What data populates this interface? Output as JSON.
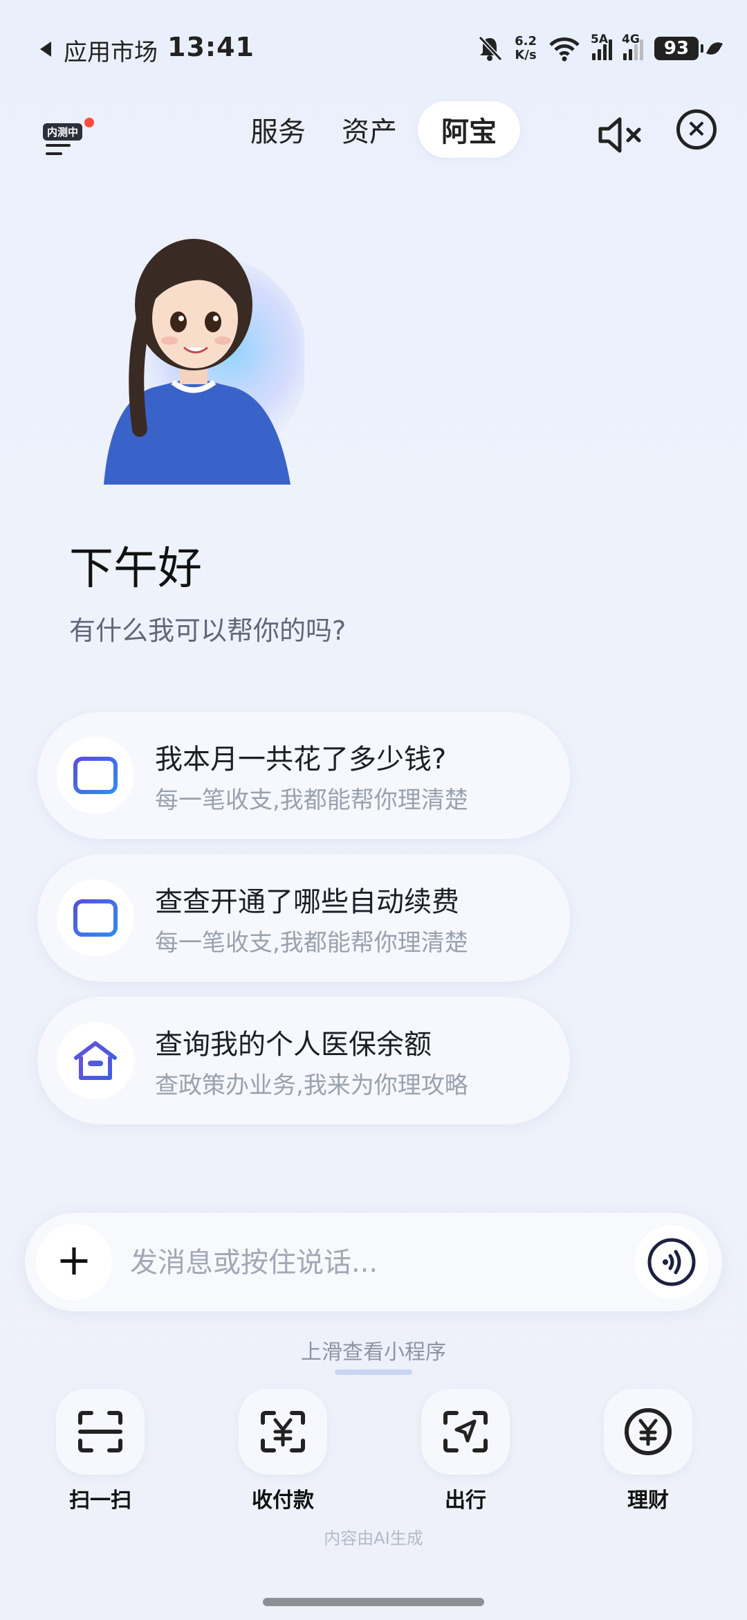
{
  "status_bar": {
    "back_app": "应用市场",
    "time": "13:41",
    "net_speed_top": "6.2",
    "net_speed_bottom": "K/s",
    "sim1_label": "5A",
    "sim2_label": "4G",
    "battery": "93"
  },
  "header": {
    "beta_badge": "内测中",
    "tabs": [
      {
        "label": "服务"
      },
      {
        "label": "资产"
      },
      {
        "label": "阿宝",
        "active": true
      }
    ],
    "close_label": "×"
  },
  "greeting": {
    "title": "下午好",
    "subtitle": "有什么我可以帮你的吗?"
  },
  "suggestions": [
    {
      "title": "我本月一共花了多少钱?",
      "subtitle": "每一笔收支,我都能帮你理清楚",
      "icon": "wallet-icon"
    },
    {
      "title": "查查开通了哪些自动续费",
      "subtitle": "每一笔收支,我都能帮你理清楚",
      "icon": "wallet-icon"
    },
    {
      "title": "查询我的个人医保余额",
      "subtitle": "查政策办业务,我来为你理攻略",
      "icon": "house-icon"
    }
  ],
  "input": {
    "plus_label": "+",
    "placeholder": "发消息或按住说话..."
  },
  "swipe_hint": "上滑查看小程序",
  "shortcuts": [
    {
      "label": "扫一扫",
      "icon": "scan-icon"
    },
    {
      "label": "收付款",
      "icon": "payment-icon"
    },
    {
      "label": "出行",
      "icon": "navigation-icon"
    },
    {
      "label": "理财",
      "icon": "yuan-coin-icon"
    }
  ],
  "ai_note": "内容由AI生成",
  "colors": {
    "accent_blue": "#3f5fe0",
    "accent_purple": "#6a4fd8",
    "background": "#eef2fb"
  }
}
